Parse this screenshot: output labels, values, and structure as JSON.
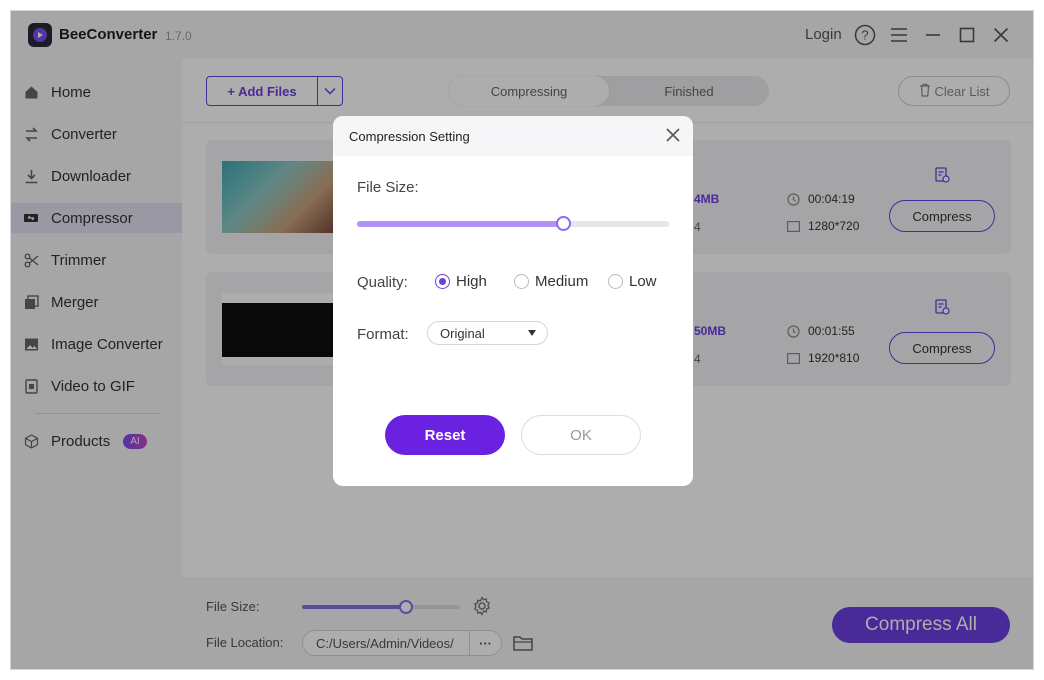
{
  "app": {
    "name": "BeeConverter",
    "version": "1.7.0",
    "login": "Login"
  },
  "sidebar": {
    "items": [
      {
        "label": "Home"
      },
      {
        "label": "Converter"
      },
      {
        "label": "Downloader"
      },
      {
        "label": "Compressor"
      },
      {
        "label": "Trimmer"
      },
      {
        "label": "Merger"
      },
      {
        "label": "Image Converter"
      },
      {
        "label": "Video to GIF"
      },
      {
        "label": "Products"
      }
    ],
    "active_index": 3,
    "ai_badge": "AI"
  },
  "toolbar": {
    "add_files": "+ Add Files",
    "tabs": [
      "Compressing",
      "Finished"
    ],
    "active_tab": "Compressing",
    "clear_list": "Clear List"
  },
  "files": [
    {
      "size": "4MB",
      "duration": "00:04:19",
      "resolution": "1280*720",
      "extra": "4",
      "compress_label": "Compress"
    },
    {
      "size": "50MB",
      "duration": "00:01:55",
      "resolution": "1920*810",
      "extra": "4",
      "compress_label": "Compress"
    }
  ],
  "footer": {
    "file_size_label": "File Size:",
    "file_size_level": 0.66,
    "file_location_label": "File Location:",
    "file_location_value": "C:/Users/Admin/Videos/",
    "more_label": "···",
    "compress_all": "Compress All"
  },
  "dialog": {
    "title": "Compression Setting",
    "file_size_label": "File Size:",
    "file_size_level": 0.66,
    "quality_label": "Quality:",
    "quality_options": [
      "High",
      "Medium",
      "Low"
    ],
    "quality_selected": "High",
    "format_label": "Format:",
    "format_value": "Original",
    "reset": "Reset",
    "ok": "OK"
  },
  "colors": {
    "accent": "#6a3ee0",
    "accent_dark": "#6a22e0",
    "slider": "#b392f5"
  },
  "icons": [
    "home-icon",
    "converter-icon",
    "downloader-icon",
    "compressor-icon",
    "trimmer-icon",
    "merger-icon",
    "image-icon",
    "gif-icon",
    "products-icon",
    "help-icon",
    "menu-icon",
    "minimize-icon",
    "maximize-icon",
    "close-icon",
    "trash-icon",
    "gear-icon",
    "folder-icon",
    "edit-icon",
    "clock-icon",
    "resolution-icon"
  ]
}
